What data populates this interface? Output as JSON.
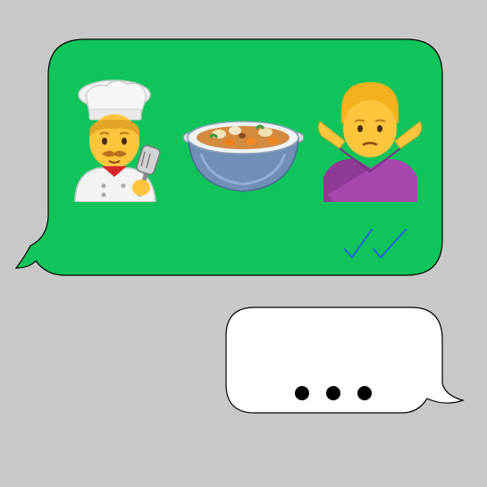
{
  "message": {
    "emojis": [
      {
        "icon": "man-cook-emoji-icon"
      },
      {
        "icon": "pot-of-food-emoji-icon"
      },
      {
        "icon": "man-gesturing-no-emoji-icon"
      }
    ],
    "status_icon": "double-check-read-icon",
    "bubble_color": "#0fc45a",
    "receipt_color": "#1d6fd1"
  },
  "reply": {
    "state_icon": "typing-indicator-icon",
    "bubble_color": "#ffffff"
  },
  "background_color": "#c8c8c8"
}
